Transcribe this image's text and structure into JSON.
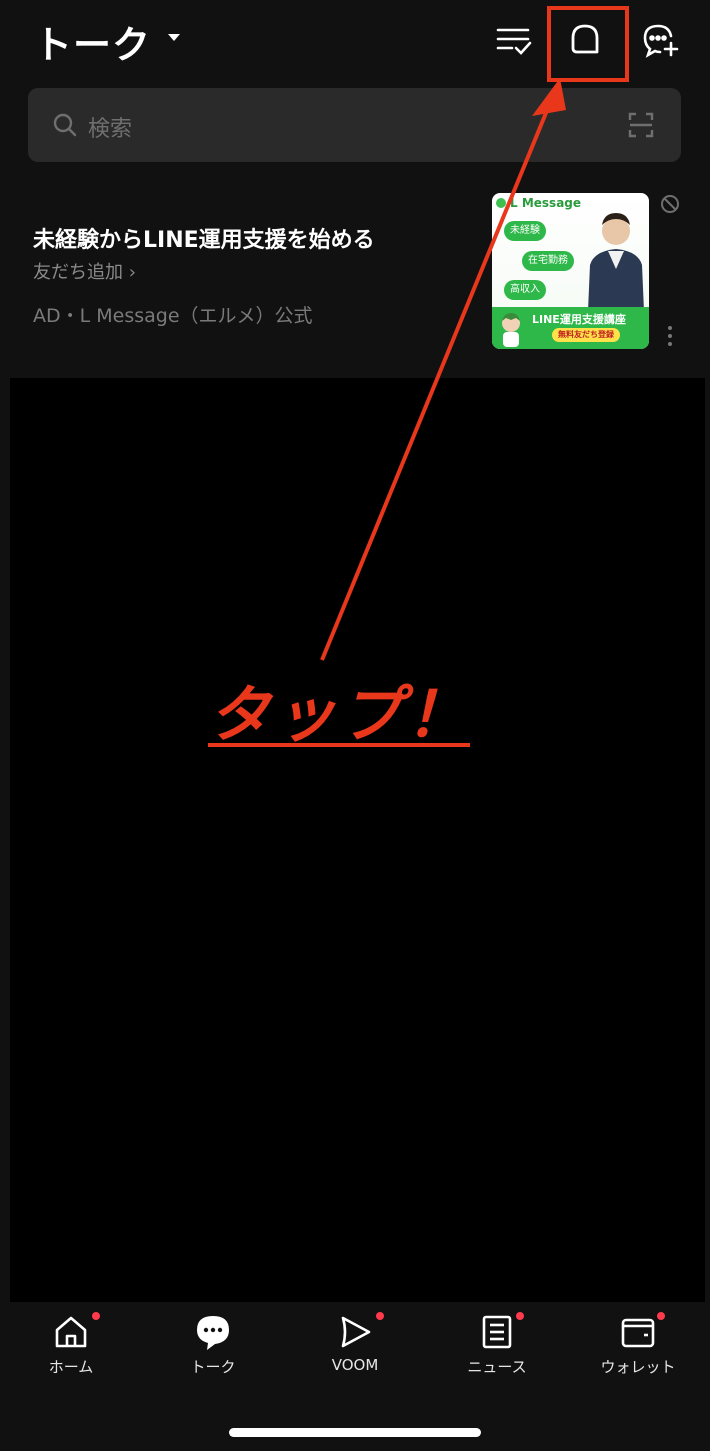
{
  "header": {
    "title": "トーク",
    "icons": {
      "edit": "list-check-icon",
      "openchat": "openchat-icon",
      "new_chat": "new-chat-icon"
    }
  },
  "search": {
    "placeholder": "検索",
    "icon": "search-icon",
    "scan_icon": "scan-icon"
  },
  "ad": {
    "title": "未経験からLINE運用支援を始める",
    "link": "友だち追加 ›",
    "meta": "AD・L Message（エルメ）公式",
    "banner": {
      "logo": "L Message",
      "pills": [
        "未経験",
        "在宅勤務",
        "高収入"
      ],
      "footer": "LINE運用支援講座",
      "cta": "無料友だち登録"
    }
  },
  "annotation": {
    "text": "タップ！",
    "color": "#e8371b"
  },
  "tabbar": {
    "items": [
      {
        "label": "ホーム",
        "icon": "home-icon",
        "badge": true
      },
      {
        "label": "トーク",
        "icon": "chat-icon",
        "badge": false,
        "active": true
      },
      {
        "label": "VOOM",
        "icon": "voom-icon",
        "badge": true
      },
      {
        "label": "ニュース",
        "icon": "news-icon",
        "badge": true
      },
      {
        "label": "ウォレット",
        "icon": "wallet-icon",
        "badge": true
      }
    ]
  },
  "colors": {
    "background": "#111111",
    "accent": "#e8371b",
    "badge": "#ff3a4c",
    "line_green": "#2eb84a"
  }
}
